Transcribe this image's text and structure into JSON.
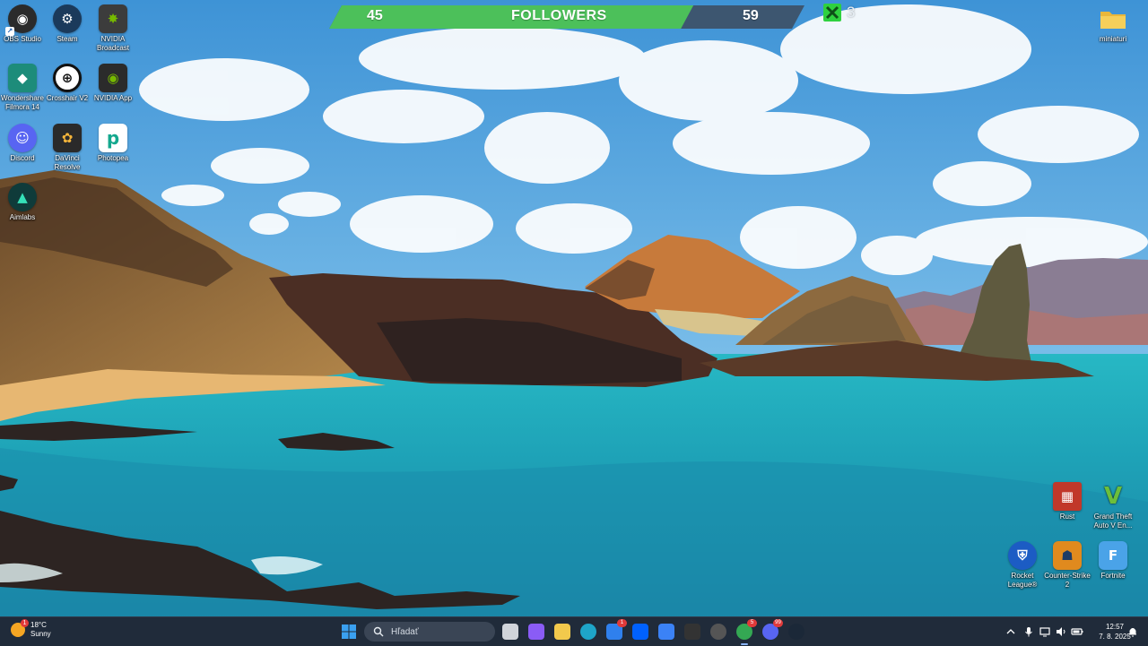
{
  "desktop_icons": [
    {
      "label": "OBS Studio",
      "icon": "obs-icon",
      "color": "#2b2b2b",
      "glyph": "◉"
    },
    {
      "label": "Steam",
      "icon": "steam-icon",
      "color": "#1b3a5b",
      "glyph": "⚙"
    },
    {
      "label": "NVIDIA Broadcast",
      "icon": "nvidia-broadcast-icon",
      "color": "#3c3c3c",
      "glyph": "✸"
    },
    {
      "label": "Wondershare Filmora 14",
      "icon": "filmora-icon",
      "color": "#1d8c7a",
      "glyph": "◆"
    },
    {
      "label": "Crosshair V2",
      "icon": "crosshair-icon",
      "color": "#ffffff",
      "glyph": "⊕"
    },
    {
      "label": "NVIDIA App",
      "icon": "nvidia-app-icon",
      "color": "#4a8f20",
      "glyph": "◉"
    },
    {
      "label": "Discord",
      "icon": "discord-icon",
      "color": "#5865f2",
      "glyph": "☺"
    },
    {
      "label": "DaVinci Resolve",
      "icon": "davinci-icon",
      "color": "#2a2a2a",
      "glyph": "✿"
    },
    {
      "label": "Photopea",
      "icon": "photopea-icon",
      "color": "#14a88e",
      "glyph": "p"
    },
    {
      "label": "Aimlabs",
      "icon": "aimlabs-icon",
      "color": "#0f3b3a",
      "glyph": "▲"
    },
    {
      "label": "miniaturi",
      "icon": "folder-icon",
      "color": "#f2c94c",
      "glyph": ""
    },
    {
      "label": "Rust",
      "icon": "rust-icon",
      "color": "#c1382a",
      "glyph": "▦"
    },
    {
      "label": "Grand Theft Auto V En...",
      "icon": "gta-icon",
      "color": "#2d4a1e",
      "glyph": "V"
    },
    {
      "label": "Rocket League®",
      "icon": "rocket-league-icon",
      "color": "#1c5cc4",
      "glyph": "⛨"
    },
    {
      "label": "Counter-Strike 2",
      "icon": "cs2-icon",
      "color": "#e08a1e",
      "glyph": "☗"
    },
    {
      "label": "Fortnite",
      "icon": "fortnite-icon",
      "color": "#4aa3e8",
      "glyph": "F"
    }
  ],
  "followers": {
    "current": "45",
    "title": "FOLLOWERS",
    "goal": "59",
    "progress": 0.76,
    "bar_color": "#4cc05a",
    "bg_color": "#3d5670"
  },
  "game_counter": {
    "icon": "xbox-logo-icon",
    "value": "3",
    "color": "#2fd13f"
  },
  "taskbar": {
    "weather": {
      "temp": "18°C",
      "condition": "Sunny",
      "badge": "1"
    },
    "search_placeholder": "Hľadať",
    "apps": [
      {
        "name": "task-view-icon",
        "color": "#d0d4da",
        "badge": ""
      },
      {
        "name": "copilot-icon",
        "color": "#8a5cf6",
        "badge": ""
      },
      {
        "name": "file-explorer-icon",
        "color": "#f2c94c",
        "badge": ""
      },
      {
        "name": "edge-icon",
        "color": "#1ea5c9",
        "badge": ""
      },
      {
        "name": "microsoft-store-icon",
        "color": "#2f80ed",
        "badge": "1"
      },
      {
        "name": "dropbox-icon",
        "color": "#0061fe",
        "badge": ""
      },
      {
        "name": "app-icon-blue",
        "color": "#3b82f6",
        "badge": ""
      },
      {
        "name": "notion-icon",
        "color": "#333333",
        "badge": ""
      },
      {
        "name": "obs-taskbar-icon",
        "color": "#555555",
        "badge": ""
      },
      {
        "name": "chrome-icon",
        "color": "#34a853",
        "badge": "5"
      },
      {
        "name": "discord-taskbar-icon",
        "color": "#5865f2",
        "badge": "99"
      },
      {
        "name": "steam-taskbar-icon",
        "color": "#1b2838",
        "badge": ""
      }
    ],
    "clock": {
      "time": "12:57",
      "date": "7. 8. 2025"
    }
  }
}
